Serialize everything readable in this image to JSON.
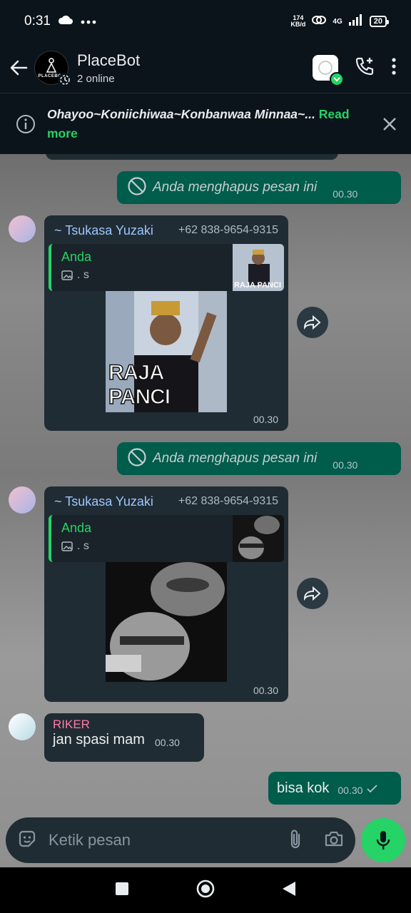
{
  "status": {
    "time": "0:31",
    "net_speed_top": "174",
    "net_speed_unit": "KB/d",
    "network": "4G",
    "battery": "20"
  },
  "header": {
    "title": "PlaceBot",
    "subtitle": "2 online",
    "avatar_text": "PLACEBOT"
  },
  "banner": {
    "text": "Ohayoo~Koniichiwaa~Konbanwaa Minnaa~...",
    "more": "Read more"
  },
  "messages": [
    {
      "type": "deleted",
      "text": "Anda menghapus pesan ini",
      "time": "00.30"
    },
    {
      "type": "reply",
      "sender": "~ Tsukasa Yuzaki",
      "phone": "+62 838-9654-9315",
      "reply_name": "Anda",
      "reply_sub": ". s",
      "caption": "RAJA PANCI",
      "thumb_caption": "RAJA PANCI",
      "time": "00.30"
    },
    {
      "type": "deleted",
      "text": "Anda menghapus pesan ini",
      "time": "00.30"
    },
    {
      "type": "reply",
      "sender": "~ Tsukasa Yuzaki",
      "phone": "+62 838-9654-9315",
      "reply_name": "Anda",
      "reply_sub": ". s",
      "time": "00.30"
    },
    {
      "type": "text_in",
      "sender": "RIKER",
      "text": "jan spasi mam",
      "time": "00.30"
    },
    {
      "type": "text_out",
      "text": "bisa kok",
      "time": "00.30"
    }
  ],
  "input": {
    "placeholder": "Ketik pesan"
  },
  "colors": {
    "accent": "#25d366",
    "outgoing": "#005c4b",
    "incoming": "#202c33"
  }
}
